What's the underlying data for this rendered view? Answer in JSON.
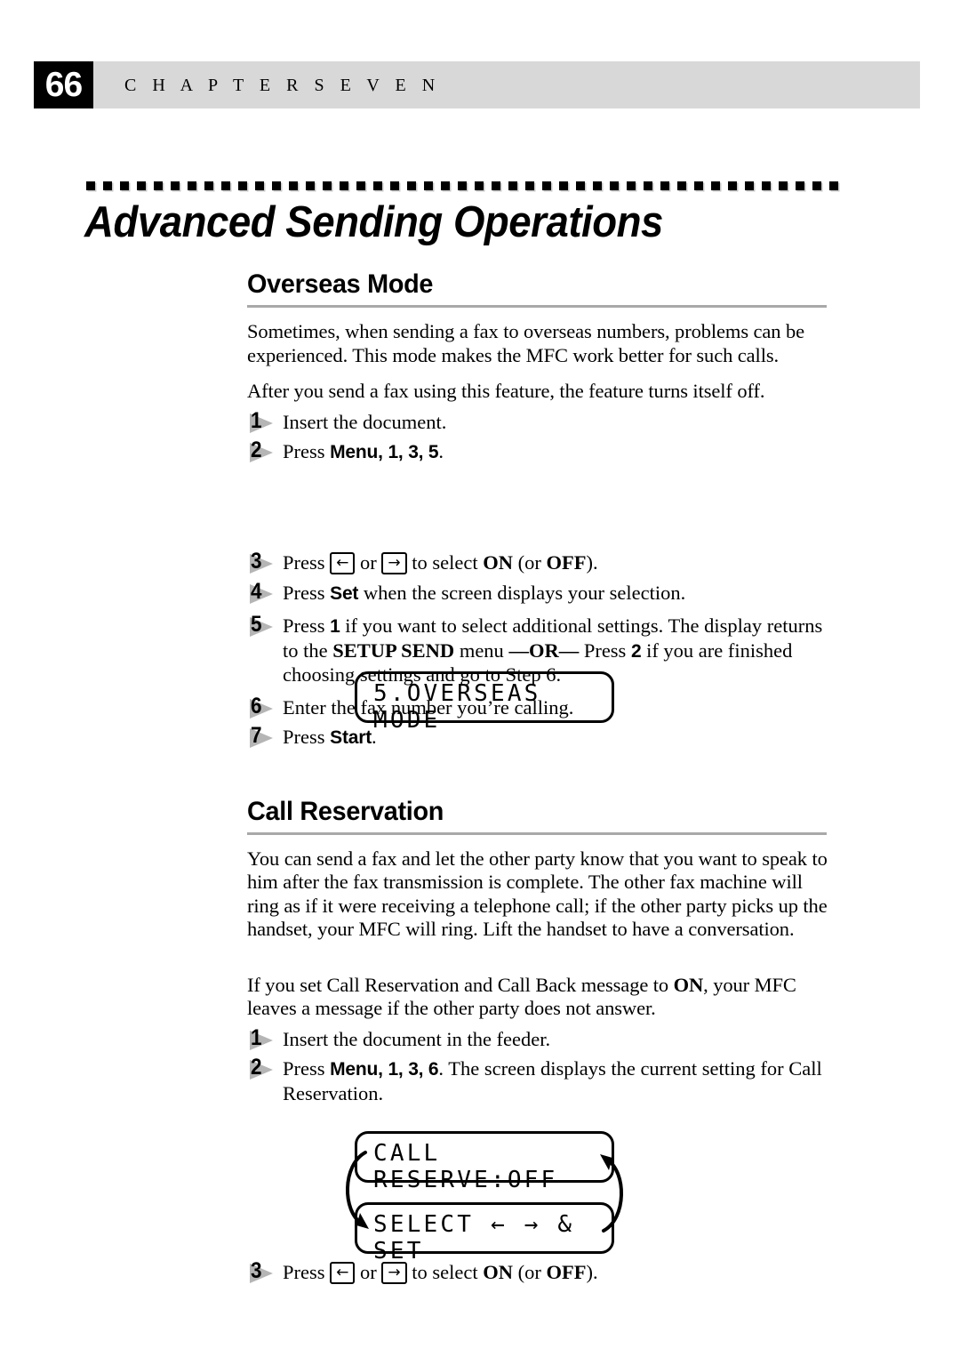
{
  "header": {
    "page_number": "66",
    "chapter_label": "C H A P T E R   S E V E N"
  },
  "chapter_title": "Advanced Sending Operations",
  "sections": [
    {
      "heading": "Overseas Mode",
      "intro": "Sometimes, when sending a fax to overseas numbers, problems can be experienced. This mode makes the MFC work better for such calls.",
      "note": "After you send a fax using this feature, the feature turns itself off.",
      "steps": {
        "n1": "1",
        "s1": "Insert the document.",
        "n2": "2",
        "s2_press": "Press ",
        "s2_menu": "Menu",
        "s2_keys": ", 1, 3, 5",
        "s2_end": ".",
        "n3": "3",
        "s3_press": "Press ",
        "s3_left_key": "←",
        "s3_or": " or ",
        "s3_right_key": "→",
        "s3_mid": " to select ",
        "s3_on": "ON",
        "s3_paren_open": " (or ",
        "s3_off": "OFF",
        "s3_paren_close": ").",
        "n4": "4",
        "s4_press": "Press ",
        "s4_set": "Set",
        "s4_rest": " when the screen displays your selection.",
        "n5": "5",
        "s5_a": "Press ",
        "s5_one": "1",
        "s5_b": " if you want to select additional settings. The display returns to the ",
        "s5_setup": "SETUP SEND",
        "s5_c": " menu ",
        "s5_or": "—OR—",
        "s5_d": " Press ",
        "s5_two": "2",
        "s5_e": " if you are finished choosing settings and go to Step 6.",
        "n6": "6",
        "s6": "Enter the fax number you’re calling.",
        "n7": "7",
        "s7_press": "Press ",
        "s7_start": "Start",
        "s7_end": "."
      },
      "lcd": "5.OVERSEAS MODE"
    },
    {
      "heading": "Call Reservation",
      "para1": "You can send a fax and let the other party know that you want to speak to him after the fax transmission is complete. The other fax machine will ring as if it were receiving a telephone call; if the other party picks up the handset, your MFC will ring. Lift the handset to have a conversation.",
      "para2_a": "If you set Call Reservation and Call Back message to ",
      "para2_on": "ON",
      "para2_b": ", your MFC leaves a message if the other party does not answer.",
      "steps": {
        "n1": "1",
        "s1": "Insert the document in the feeder.",
        "n2": "2",
        "s2_press": "Press ",
        "s2_menu": "Menu",
        "s2_keys": ", 1, 3, 6",
        "s2_rest": ". The screen displays the current setting for Call Reservation.",
        "n3": "3",
        "s3_press": "Press ",
        "s3_left_key": "←",
        "s3_or": " or ",
        "s3_right_key": "→",
        "s3_mid": " to select ",
        "s3_on": "ON",
        "s3_paren_open": " (or ",
        "s3_off": "OFF",
        "s3_paren_close": ")."
      },
      "lcd_top": "CALL RESERVE:OFF",
      "lcd_bottom": "SELECT ← → & SET"
    }
  ],
  "colors": {
    "header_band": "#d8d8d8",
    "page_box": "#000000",
    "heading_rule": "#a9a9a9",
    "step_marker": "#b5b5b5",
    "text": "#000000",
    "page_background": "#ffffff"
  }
}
